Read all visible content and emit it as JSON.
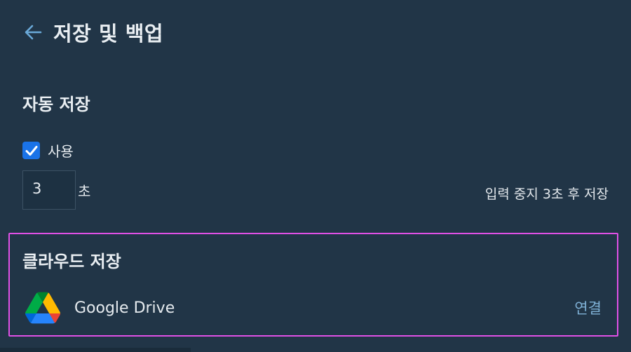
{
  "header": {
    "back_icon": "arrow-left-icon",
    "title": "저장 및 백업"
  },
  "autosave": {
    "title": "자동 저장",
    "enabled": true,
    "enabled_label": "사용",
    "seconds_value": "3",
    "seconds_unit": "초",
    "hint": "입력 중지 3초 후 저장"
  },
  "cloud": {
    "title": "클라우드 저장",
    "providers": [
      {
        "name": "Google Drive",
        "icon": "google-drive-icon",
        "action": "연결"
      }
    ]
  },
  "colors": {
    "background": "#213547",
    "accent_link": "#7fb1d6",
    "checkbox": "#1a73e8",
    "highlight_border": "#e050e6"
  }
}
